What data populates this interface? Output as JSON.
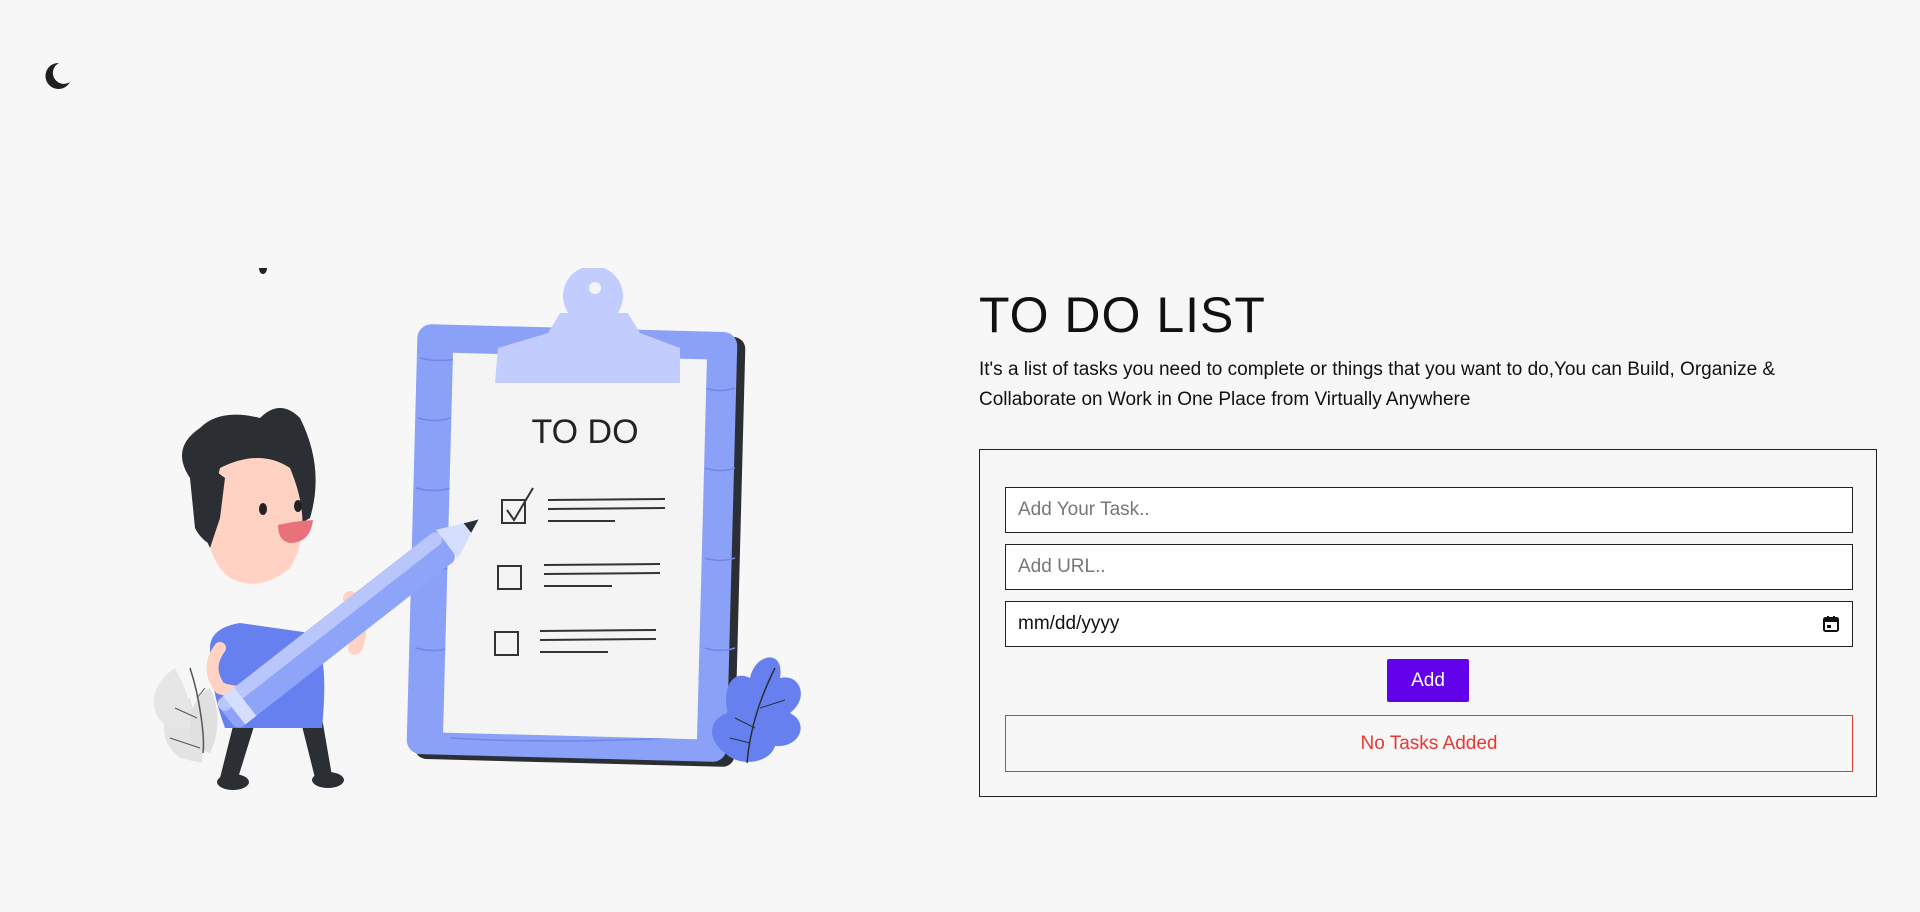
{
  "theme_toggle": {
    "icon": "moon-icon",
    "color": "#1f1f1f"
  },
  "illustration": {
    "clipboard_heading": "TO DO",
    "accent_color": "#7b93f4",
    "light_accent_color": "#c0cbfd"
  },
  "header": {
    "title": "TO DO LIST",
    "subtitle": "It's a list of tasks you need to complete or things that you want to do,You can Build, Organize & Collaborate on Work in One Place from Virtually Anywhere"
  },
  "form": {
    "task_placeholder": "Add Your Task..",
    "url_placeholder": "Add URL..",
    "date_value": "mm/dd/yyyy",
    "date_icon": "calendar-icon",
    "add_label": "Add",
    "add_color": "#6200ea"
  },
  "tasks": {
    "empty_message": "No Tasks Added",
    "empty_color": "#e53935",
    "items": []
  }
}
